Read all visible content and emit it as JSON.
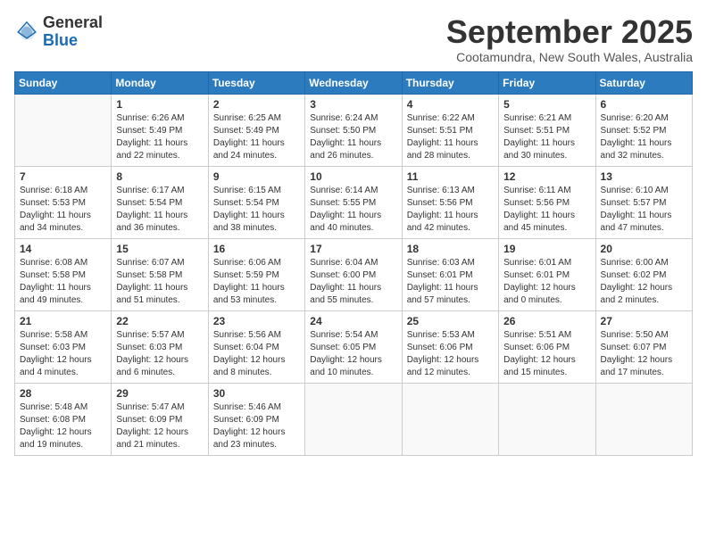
{
  "logo": {
    "general": "General",
    "blue": "Blue"
  },
  "title": "September 2025",
  "subtitle": "Cootamundra, New South Wales, Australia",
  "days_of_week": [
    "Sunday",
    "Monday",
    "Tuesday",
    "Wednesday",
    "Thursday",
    "Friday",
    "Saturday"
  ],
  "weeks": [
    [
      {
        "day": "",
        "sunrise": "",
        "sunset": "",
        "daylight": ""
      },
      {
        "day": "1",
        "sunrise": "6:26 AM",
        "sunset": "5:49 PM",
        "daylight": "11 hours and 22 minutes."
      },
      {
        "day": "2",
        "sunrise": "6:25 AM",
        "sunset": "5:49 PM",
        "daylight": "11 hours and 24 minutes."
      },
      {
        "day": "3",
        "sunrise": "6:24 AM",
        "sunset": "5:50 PM",
        "daylight": "11 hours and 26 minutes."
      },
      {
        "day": "4",
        "sunrise": "6:22 AM",
        "sunset": "5:51 PM",
        "daylight": "11 hours and 28 minutes."
      },
      {
        "day": "5",
        "sunrise": "6:21 AM",
        "sunset": "5:51 PM",
        "daylight": "11 hours and 30 minutes."
      },
      {
        "day": "6",
        "sunrise": "6:20 AM",
        "sunset": "5:52 PM",
        "daylight": "11 hours and 32 minutes."
      }
    ],
    [
      {
        "day": "7",
        "sunrise": "6:18 AM",
        "sunset": "5:53 PM",
        "daylight": "11 hours and 34 minutes."
      },
      {
        "day": "8",
        "sunrise": "6:17 AM",
        "sunset": "5:54 PM",
        "daylight": "11 hours and 36 minutes."
      },
      {
        "day": "9",
        "sunrise": "6:15 AM",
        "sunset": "5:54 PM",
        "daylight": "11 hours and 38 minutes."
      },
      {
        "day": "10",
        "sunrise": "6:14 AM",
        "sunset": "5:55 PM",
        "daylight": "11 hours and 40 minutes."
      },
      {
        "day": "11",
        "sunrise": "6:13 AM",
        "sunset": "5:56 PM",
        "daylight": "11 hours and 42 minutes."
      },
      {
        "day": "12",
        "sunrise": "6:11 AM",
        "sunset": "5:56 PM",
        "daylight": "11 hours and 45 minutes."
      },
      {
        "day": "13",
        "sunrise": "6:10 AM",
        "sunset": "5:57 PM",
        "daylight": "11 hours and 47 minutes."
      }
    ],
    [
      {
        "day": "14",
        "sunrise": "6:08 AM",
        "sunset": "5:58 PM",
        "daylight": "11 hours and 49 minutes."
      },
      {
        "day": "15",
        "sunrise": "6:07 AM",
        "sunset": "5:58 PM",
        "daylight": "11 hours and 51 minutes."
      },
      {
        "day": "16",
        "sunrise": "6:06 AM",
        "sunset": "5:59 PM",
        "daylight": "11 hours and 53 minutes."
      },
      {
        "day": "17",
        "sunrise": "6:04 AM",
        "sunset": "6:00 PM",
        "daylight": "11 hours and 55 minutes."
      },
      {
        "day": "18",
        "sunrise": "6:03 AM",
        "sunset": "6:01 PM",
        "daylight": "11 hours and 57 minutes."
      },
      {
        "day": "19",
        "sunrise": "6:01 AM",
        "sunset": "6:01 PM",
        "daylight": "12 hours and 0 minutes."
      },
      {
        "day": "20",
        "sunrise": "6:00 AM",
        "sunset": "6:02 PM",
        "daylight": "12 hours and 2 minutes."
      }
    ],
    [
      {
        "day": "21",
        "sunrise": "5:58 AM",
        "sunset": "6:03 PM",
        "daylight": "12 hours and 4 minutes."
      },
      {
        "day": "22",
        "sunrise": "5:57 AM",
        "sunset": "6:03 PM",
        "daylight": "12 hours and 6 minutes."
      },
      {
        "day": "23",
        "sunrise": "5:56 AM",
        "sunset": "6:04 PM",
        "daylight": "12 hours and 8 minutes."
      },
      {
        "day": "24",
        "sunrise": "5:54 AM",
        "sunset": "6:05 PM",
        "daylight": "12 hours and 10 minutes."
      },
      {
        "day": "25",
        "sunrise": "5:53 AM",
        "sunset": "6:06 PM",
        "daylight": "12 hours and 12 minutes."
      },
      {
        "day": "26",
        "sunrise": "5:51 AM",
        "sunset": "6:06 PM",
        "daylight": "12 hours and 15 minutes."
      },
      {
        "day": "27",
        "sunrise": "5:50 AM",
        "sunset": "6:07 PM",
        "daylight": "12 hours and 17 minutes."
      }
    ],
    [
      {
        "day": "28",
        "sunrise": "5:48 AM",
        "sunset": "6:08 PM",
        "daylight": "12 hours and 19 minutes."
      },
      {
        "day": "29",
        "sunrise": "5:47 AM",
        "sunset": "6:09 PM",
        "daylight": "12 hours and 21 minutes."
      },
      {
        "day": "30",
        "sunrise": "5:46 AM",
        "sunset": "6:09 PM",
        "daylight": "12 hours and 23 minutes."
      },
      {
        "day": "",
        "sunrise": "",
        "sunset": "",
        "daylight": ""
      },
      {
        "day": "",
        "sunrise": "",
        "sunset": "",
        "daylight": ""
      },
      {
        "day": "",
        "sunrise": "",
        "sunset": "",
        "daylight": ""
      },
      {
        "day": "",
        "sunrise": "",
        "sunset": "",
        "daylight": ""
      }
    ]
  ]
}
